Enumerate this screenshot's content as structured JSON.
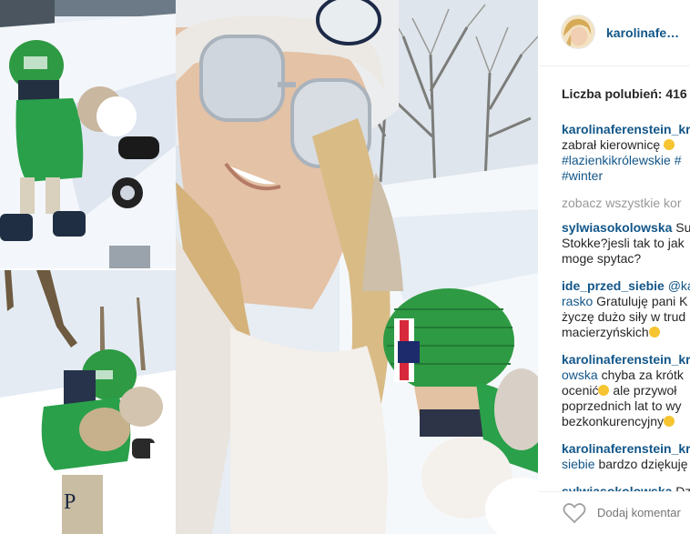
{
  "post": {
    "username": "karolinafe…",
    "likes_label": "Liczba polubień: 416"
  },
  "caption": {
    "username": "karolinaferenstein_kr",
    "text": "zabrał kierownicę",
    "hashtags": [
      "#lazienkikrólewskie",
      "#",
      "#winter"
    ]
  },
  "view_all": "zobacz wszystkie kor",
  "comments": [
    {
      "username": "sylwiasokolowska",
      "lines": [
        "Su",
        "Stokke?jesli tak to jak",
        "moge spytac?"
      ]
    },
    {
      "username": "ide_przed_siebie",
      "mention": "@ka",
      "mention2": "rasko",
      "lines": [
        "Gratuluję pani K",
        "życzę dużo siły w trud",
        "macierzyńskich"
      ]
    },
    {
      "username": "karolinaferenstein_kr",
      "mention": "owska",
      "lines": [
        "chyba za krótk",
        "ocenić",
        "ale przywoł",
        "poprzednich lat to wy",
        "bezkonkurencyjny"
      ]
    },
    {
      "username": "karolinaferenstein_kr",
      "mention": "siebie",
      "lines": [
        "bardzo dziękuję"
      ]
    },
    {
      "username": "sylwiasokolowska",
      "lines": [
        "Dz"
      ]
    }
  ],
  "comment_bar": {
    "placeholder": "Dodaj komentar"
  },
  "colors": {
    "link": "#125688",
    "hat_green": "#2e9a43",
    "coat_green": "#2aa04a",
    "snow": "#f2f6fb"
  },
  "icons": [
    "heart-icon",
    "avatar"
  ]
}
